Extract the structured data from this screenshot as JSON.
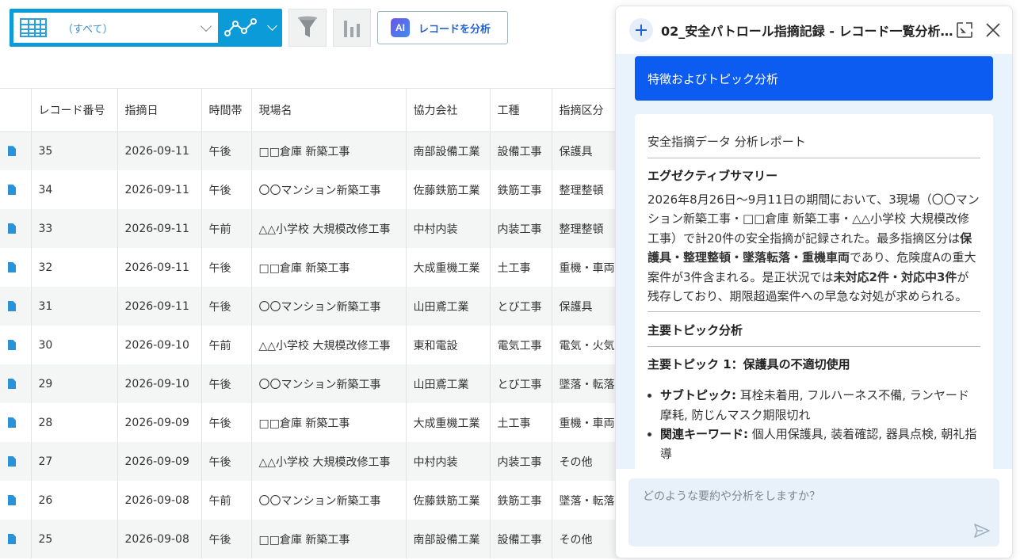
{
  "toolbar": {
    "view_label": "（すべて）",
    "ai_badge": "AI",
    "ai_button_label": "レコードを分析"
  },
  "table": {
    "columns": [
      "",
      "レコード番号",
      "指摘日",
      "時間帯",
      "現場名",
      "協力会社",
      "工種",
      "指摘区分"
    ],
    "rows": [
      [
        "35",
        "2026-09-11",
        "午後",
        "□□倉庫 新築工事",
        "南部設備工業",
        "設備工事",
        "保護具"
      ],
      [
        "34",
        "2026-09-11",
        "午後",
        "〇〇マンション新築工事",
        "佐藤鉄筋工業",
        "鉄筋工事",
        "整理整頓"
      ],
      [
        "33",
        "2026-09-11",
        "午前",
        "△△小学校 大規模改修工事",
        "中村内装",
        "内装工事",
        "整理整頓"
      ],
      [
        "32",
        "2026-09-11",
        "午後",
        "□□倉庫 新築工事",
        "大成重機工業",
        "土工事",
        "重機・車両"
      ],
      [
        "31",
        "2026-09-11",
        "午後",
        "〇〇マンション新築工事",
        "山田鳶工業",
        "とび工事",
        "保護具"
      ],
      [
        "30",
        "2026-09-10",
        "午前",
        "△△小学校 大規模改修工事",
        "東和電設",
        "電気工事",
        "電気・火気"
      ],
      [
        "29",
        "2026-09-10",
        "午後",
        "〇〇マンション新築工事",
        "山田鳶工業",
        "とび工事",
        "墜落・転落"
      ],
      [
        "28",
        "2026-09-09",
        "午後",
        "□□倉庫 新築工事",
        "大成重機工業",
        "土工事",
        "重機・車両"
      ],
      [
        "27",
        "2026-09-09",
        "午後",
        "△△小学校 大規模改修工事",
        "中村内装",
        "内装工事",
        "その他"
      ],
      [
        "26",
        "2026-09-08",
        "午前",
        "〇〇マンション新築工事",
        "佐藤鉄筋工業",
        "鉄筋工事",
        "墜落・転落"
      ],
      [
        "25",
        "2026-09-08",
        "午後",
        "□□倉庫 新築工事",
        "南部設備工業",
        "設備工事",
        "その他"
      ]
    ]
  },
  "panel": {
    "title": "02_安全パトロール指摘記録 - レコード一覧分析…",
    "topic_chip": "特徴およびトピック分析",
    "report_title": "安全指摘データ 分析レポート",
    "exec_heading": "エグゼクティブサマリー",
    "exec_text_1": "2026年8月26日〜9月11日の期間において、3現場（〇〇マンション新築工事・□□倉庫 新築工事・△△小学校 大規模改修工事）で計20件の安全指摘が記録された。最多指摘区分は",
    "exec_bold_1": "保護具・整理整頓・墜落転落・重機車両",
    "exec_text_2": "であり、危険度Aの重大案件が3件含まれる。是正状況では",
    "exec_bold_2": "未対応2件・対応中3件",
    "exec_text_3": "が残存しており、期限超過案件への早急な対処が求められる。",
    "topics_heading": "主要トピック分析",
    "topic1_heading": "主要トピック 1：保護具の不適切使用",
    "subtopic_label": "サブトピック:",
    "subtopic_text": " 耳栓未着用, フルハーネス不備, ランヤード摩耗, 防じんマスク期限切れ",
    "keywords_label": "関連キーワード:",
    "keywords_text": " 個人用保護具, 装着確認, 器具点検, 朝礼指導",
    "input_placeholder": "どのような要約や分析をしますか？"
  },
  "colors": {
    "toolbar_blue": "#0b9bd8",
    "chip_blue": "#0c5cf2",
    "panel_bg": "#e9f3fb"
  }
}
